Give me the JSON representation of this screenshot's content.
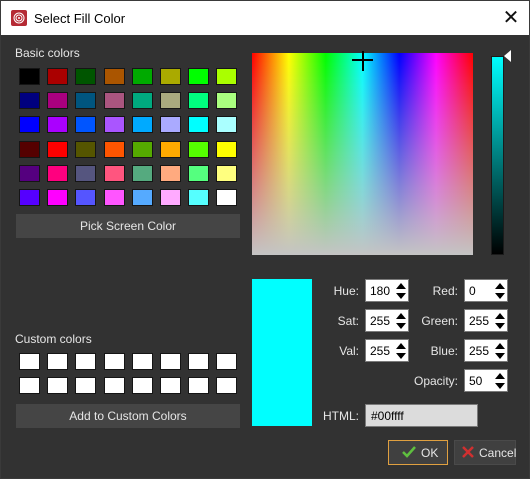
{
  "window": {
    "title": "Select Fill Color"
  },
  "basic_colors": {
    "label": "Basic colors",
    "swatches": [
      [
        "#000000",
        "#aa0000",
        "#005500",
        "#aa5500",
        "#00aa00",
        "#aaaa00",
        "#00ff00",
        "#aaff00"
      ],
      [
        "#00007f",
        "#aa007f",
        "#00557f",
        "#aa557f",
        "#00aa7f",
        "#aaaa7f",
        "#00ff7f",
        "#aaff7f"
      ],
      [
        "#0000ff",
        "#aa00ff",
        "#0055ff",
        "#aa55ff",
        "#00aaff",
        "#aaaaff",
        "#00ffff",
        "#aaffff"
      ],
      [
        "#550000",
        "#ff0000",
        "#555500",
        "#ff5500",
        "#55aa00",
        "#ffaa00",
        "#55ff00",
        "#ffff00"
      ],
      [
        "#55007f",
        "#ff007f",
        "#55557f",
        "#ff557f",
        "#55aa7f",
        "#ffaa7f",
        "#55ff7f",
        "#ffff7f"
      ],
      [
        "#5500ff",
        "#ff00ff",
        "#5555ff",
        "#ff55ff",
        "#55aaff",
        "#ffaaff",
        "#55ffff",
        "#ffffff"
      ]
    ]
  },
  "pick_screen_color_label": "Pick Screen Color",
  "custom_colors": {
    "label": "Custom colors",
    "count": 16
  },
  "add_custom_label": "Add to Custom Colors",
  "current_color": "#00ffff",
  "fields": {
    "hue": {
      "label": "Hue:",
      "value": "180"
    },
    "sat": {
      "label": "Sat:",
      "value": "255"
    },
    "val": {
      "label": "Val:",
      "value": "255"
    },
    "red": {
      "label": "Red:",
      "value": "0"
    },
    "green": {
      "label": "Green:",
      "value": "255"
    },
    "blue": {
      "label": "Blue:",
      "value": "255"
    },
    "opacity": {
      "label": "Opacity:",
      "value": "50"
    },
    "html": {
      "label": "HTML:",
      "value": "#00ffff"
    }
  },
  "buttons": {
    "ok": "OK",
    "cancel": "Cancel"
  },
  "colors": {
    "accent_border": "#e0a040",
    "ok_check": "#5fbf3f",
    "cancel_x": "#d03030"
  }
}
